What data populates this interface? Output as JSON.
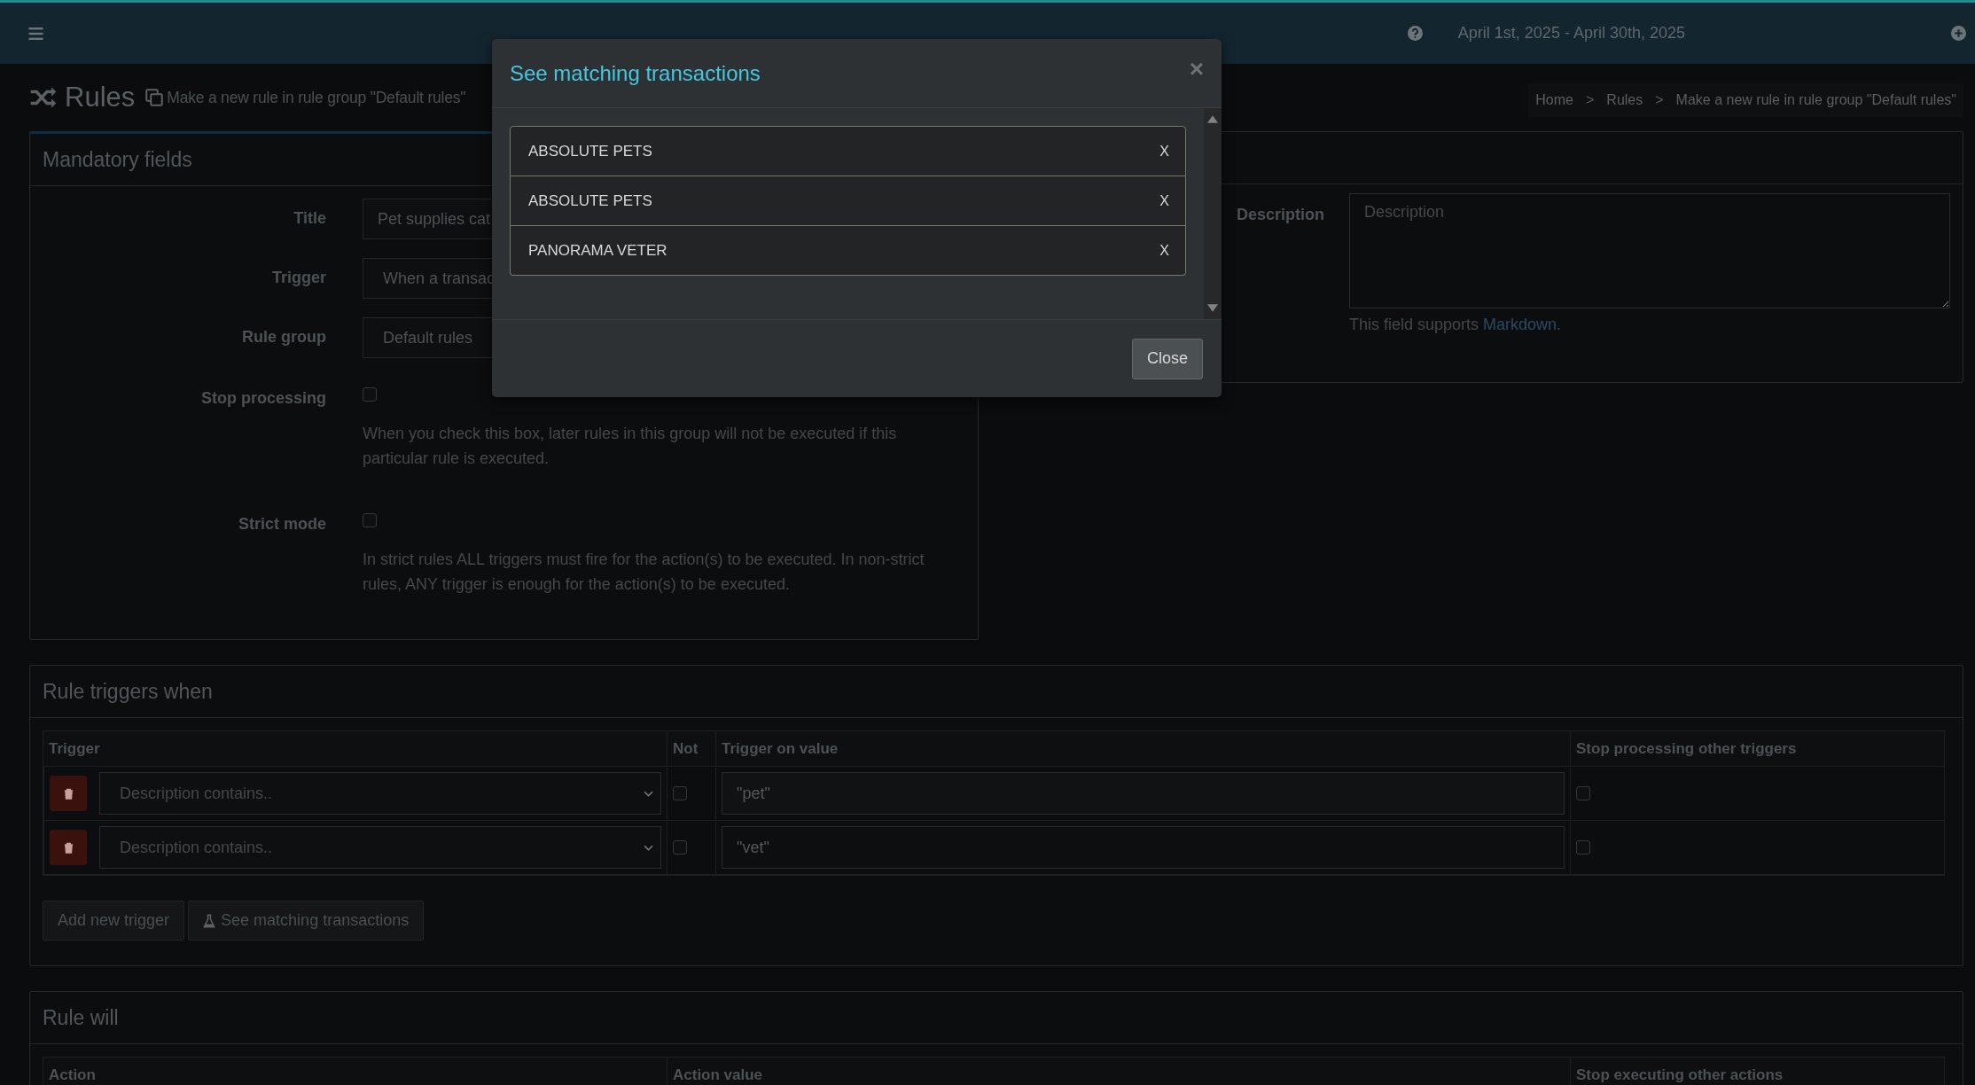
{
  "topbar": {
    "date_range": "April 1st, 2025 - April 30th, 2025"
  },
  "page": {
    "title": "Rules",
    "subtitle": "Make a new rule in rule group \"Default rules\""
  },
  "breadcrumb": {
    "separator": ">",
    "items": [
      "Home",
      "Rules",
      "Make a new rule in rule group \"Default rules\""
    ]
  },
  "mandatory": {
    "heading": "Mandatory fields",
    "fields": [
      {
        "kind": "input",
        "label": "Title",
        "value": "Pet supplies cat"
      },
      {
        "kind": "select",
        "label": "Trigger",
        "value": "When a transac"
      },
      {
        "kind": "select",
        "label": "Rule group",
        "value": "Default rules"
      },
      {
        "kind": "checkbox",
        "label": "Stop processing",
        "checked": false,
        "help": "When you check this box, later rules in this group will not be executed if this particular rule is executed."
      },
      {
        "kind": "checkbox",
        "label": "Strict mode",
        "checked": false,
        "help": "In strict rules ALL triggers must fire for the action(s) to be executed. In non-strict rules, ANY trigger is enough for the action(s) to be executed."
      }
    ]
  },
  "description": {
    "label": "Description",
    "placeholder": "Description",
    "help": "This field supports ",
    "link": "Markdown",
    "help_end": "."
  },
  "triggers": {
    "heading": "Rule triggers when",
    "columns": [
      "Trigger",
      "Not",
      "Trigger on value",
      "Stop processing other triggers"
    ],
    "rows": [
      {
        "trigger": "Description contains..",
        "not": false,
        "value": "\"pet\"",
        "stop": false
      },
      {
        "trigger": "Description contains..",
        "not": false,
        "value": "\"vet\"",
        "stop": false
      }
    ],
    "buttons": [
      {
        "kind": "plain",
        "label": "Add new trigger"
      },
      {
        "kind": "flask",
        "label": "See matching transactions"
      }
    ]
  },
  "actions": {
    "heading": "Rule will",
    "columns": [
      "Action",
      "Action value",
      "Stop executing other actions"
    ]
  },
  "modal": {
    "title": "See matching transactions",
    "close_symbol": "×",
    "items": [
      {
        "name": "ABSOLUTE PETS",
        "remove": "X"
      },
      {
        "name": "ABSOLUTE PETS",
        "remove": "X"
      },
      {
        "name": "PANORAMA VETER",
        "remove": "X"
      }
    ],
    "close_button": "Close"
  }
}
